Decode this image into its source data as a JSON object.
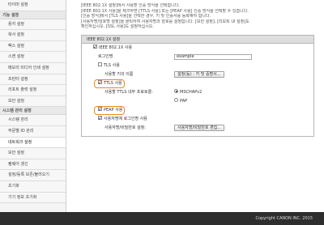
{
  "sidebar": {
    "items": [
      {
        "label": "타이머 설정",
        "type": "item"
      },
      {
        "label": "기능 설정",
        "type": "section"
      },
      {
        "label": "용지 설정",
        "type": "item"
      },
      {
        "label": "복사 설정",
        "type": "item"
      },
      {
        "label": "팩스 설정",
        "type": "item"
      },
      {
        "label": "스캔 설정",
        "type": "item"
      },
      {
        "label": "메모리 미디어 인쇄 설정",
        "type": "item"
      },
      {
        "label": "프린터 설정",
        "type": "item"
      },
      {
        "label": "리포트 출력 설정",
        "type": "item"
      },
      {
        "label": "보안 설정",
        "type": "item"
      },
      {
        "label": "시스템 관리 설정",
        "type": "section"
      },
      {
        "label": "시스템 관리",
        "type": "item"
      },
      {
        "label": "부문별 ID 관리",
        "type": "item"
      },
      {
        "label": "네트워크 설정",
        "type": "item",
        "active": true
      },
      {
        "label": "보안 설정",
        "type": "item"
      },
      {
        "label": "펌웨어 갱신",
        "type": "item"
      },
      {
        "label": "설정/등록 보존/불러오기",
        "type": "item"
      },
      {
        "label": "초기화",
        "type": "item"
      },
      {
        "label": "기기 정보 초기화",
        "type": "item"
      }
    ]
  },
  "notes": [
    "[IEEE 802.1X 설정]에서 사용할 인증 방식을 선택합니다.",
    "[IEEE 802.1X 사용]을 체크하면 [TTLS 사용] 또는 [PEAP 사용] 인증 방식을 선택할 수 있습니다.",
    "[인증 방식]에서 [TLS 사용]을 선택한 경우, 키 및 인증서를 등록해야 합니다.",
    "[사용자명/암호명 설정]을 클릭하여 사용자명과 암호를 설정합니다. [보안 설정], [리모트 UI 설정]도",
    "확인하십시오. [SSL 사용]도 설정하십시오."
  ],
  "panel": {
    "title": "IEEE 802.1X 설정",
    "ieee_label": "IEEE 802.1X 사용",
    "login_name_label": "로그인명",
    "login_name_value": "example",
    "tls_label": "TLS 사용",
    "key_name_label": "사용할 키의 이름",
    "key_button": "설정(등) : 키 및 증명서...",
    "ttls_label": "TTLS 사용",
    "ttls_protocol_label": "사용할 TTLS 내부 프로토콜:",
    "mschapv2_label": "MSCHAPv2",
    "pap_label": "PAP",
    "peap_label": "PEAP 사용",
    "use_login_as_user_label": "사용자명에 로그인명 사용",
    "user_pass_label": "사용자명/비밀번호 설정:",
    "user_pass_button": "사용자명/비밀번호 편집..."
  },
  "footer": {
    "copyright": "Copyright CANON INC. 2015"
  },
  "colors": {
    "highlight": "#e88a1a",
    "footer_bg": "#2e2e2e"
  }
}
